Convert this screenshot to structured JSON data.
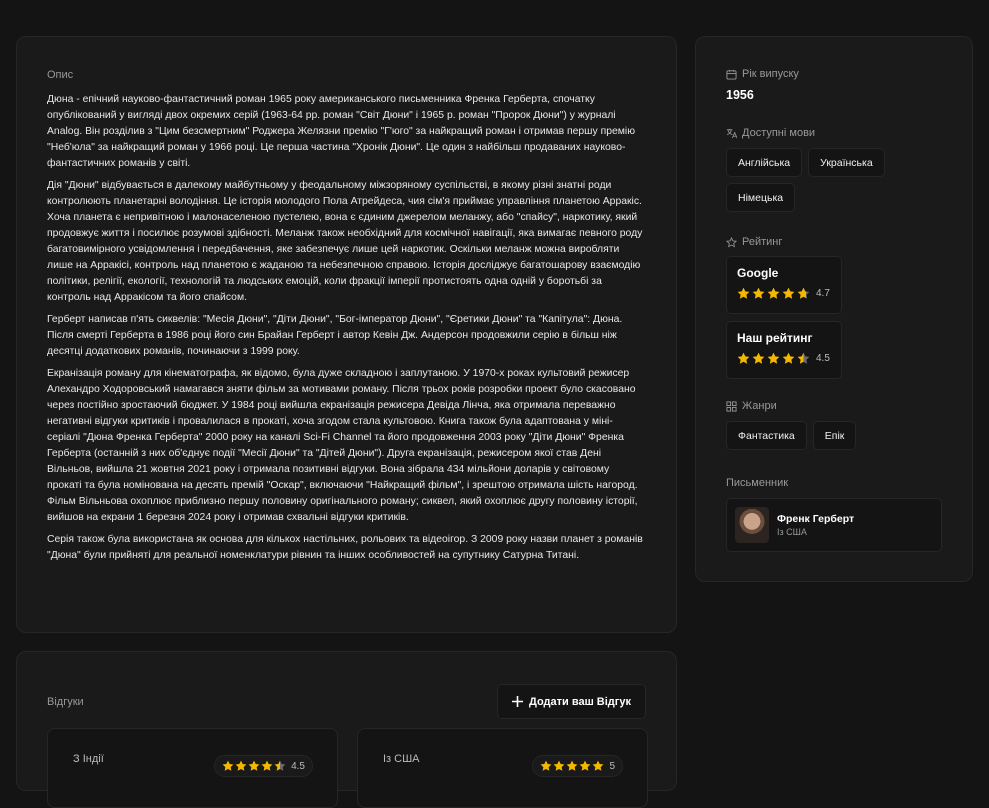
{
  "description": {
    "label": "Опис",
    "paragraphs": [
      "Дюна - епічний науково-фантастичний роман 1965 року американського письменника Френка Герберта, спочатку опублікований у вигляді двох окремих серій (1963-64 рр. роман \"Світ Дюни\" і 1965 р. роман \"Пророк Дюни\") у журналі Analog. Він розділив з \"Цим безсмертним\" Роджера Желязни премію \"Г'юго\" за найкращий роман і отримав першу премію \"Неб'юла\" за найкращий роман у 1966 році. Це перша частина \"Хронік Дюни\". Це один з найбільш продаваних науково-фантастичних романів у світі.",
      "Дія \"Дюни\" відбувається в далекому майбутньому у феодальному міжзоряному суспільстві, в якому різні знатні роди контролюють планетарні володіння. Це історія молодого Пола Атрейдеса, чия сім'я приймає управління планетою Арракіс. Хоча планета є непривітною і малонаселеною пустелею, вона є єдиним джерелом меланжу, або \"спайсу\", наркотику, який продовжує життя і посилює розумові здібності. Меланж також необхідний для космічної навігації, яка вимагає певного роду багатовимірного усвідомлення і передбачення, яке забезпечує лише цей наркотик. Оскільки меланж можна виробляти лише на Арракісі, контроль над планетою є жаданою та небезпечною справою. Історія досліджує багатошарову взаємодію політики, релігії, екології, технологій та людських емоцій, коли фракції імперії протистоять одна одній у боротьбі за контроль над Арракісом та його спайсом.",
      "Герберт написав п'ять сиквелів: \"Месія Дюни\", \"Діти Дюни\", \"Бог-імператор Дюни\", \"Єретики Дюни\" та \"Капітула\": Дюна. Після смерті Герберта в 1986 році його син Брайан Герберт і автор Кевін Дж. Андерсон продовжили серію в більш ніж десятці додаткових романів, починаючи з 1999 року.",
      "Екранізація роману для кінематографа, як відомо, була дуже складною і заплутаною. У 1970-х роках культовий режисер Алехандро Ходоровський намагався зняти фільм за мотивами роману. Після трьох років розробки проект було скасовано через постійно зростаючий бюджет. У 1984 році вийшла екранізація режисера Девіда Лінча, яка отримала переважно негативні відгуки критиків і провалилася в прокаті, хоча згодом стала культовою. Книга також була адаптована у міні-серіалі \"Дюна Френка Герберта\" 2000 року на каналі Sci-Fi Channel та його продовження 2003 року \"Діти Дюни\" Френка Герберта (останній з них об'єднує події \"Месії Дюни\" та \"Дітей Дюни\"). Друга екранізація, режисером якої став Дені Вільньов, вийшла 21 жовтня 2021 року і отримала позитивні відгуки. Вона зібрала 434 мільйони доларів у світовому прокаті та була номінована на десять премій \"Оскар\", включаючи \"Найкращий фільм\", і зрештою отримала шість нагород. Фільм Вільньова охоплює приблизно першу половину оригінального роману; сиквел, який охоплює другу половину історії, вийшов на екрани 1 березня 2024 року і отримав схвальні відгуки критиків.",
      "Серія також була використана як основа для кількох настільних, рольових та відеоігор. З 2009 року назви планет з романів \"Дюна\" були прийняті для реальної номенклатури рівнин та інших особливостей на супутнику Сатурна Титані."
    ]
  },
  "sidebar": {
    "release": {
      "label": "Рік випуску",
      "value": "1956"
    },
    "languages": {
      "label": "Доступні мови",
      "items": [
        "Англійська",
        "Українська",
        "Німецька"
      ]
    },
    "ratings": {
      "label": "Рейтинг",
      "items": [
        {
          "name": "Google",
          "value": "4.7",
          "stars": 4.7
        },
        {
          "name": "Наш рейтинг",
          "value": "4.5",
          "stars": 4.5
        }
      ]
    },
    "genres": {
      "label": "Жанри",
      "items": [
        "Фантастика",
        "Епік"
      ]
    },
    "writer": {
      "label": "Письменник",
      "name": "Френк Герберт",
      "origin": "Із США"
    }
  },
  "reviews": {
    "label": "Відгуки",
    "add_label": "Додати ваш Відгук",
    "items": [
      {
        "origin": "З Індії",
        "value": "4.5",
        "stars": 4.5
      },
      {
        "origin": "Із США",
        "value": "5",
        "stars": 5
      }
    ]
  },
  "colors": {
    "star": "#f5b800",
    "star_empty": "#6b6b6b"
  }
}
